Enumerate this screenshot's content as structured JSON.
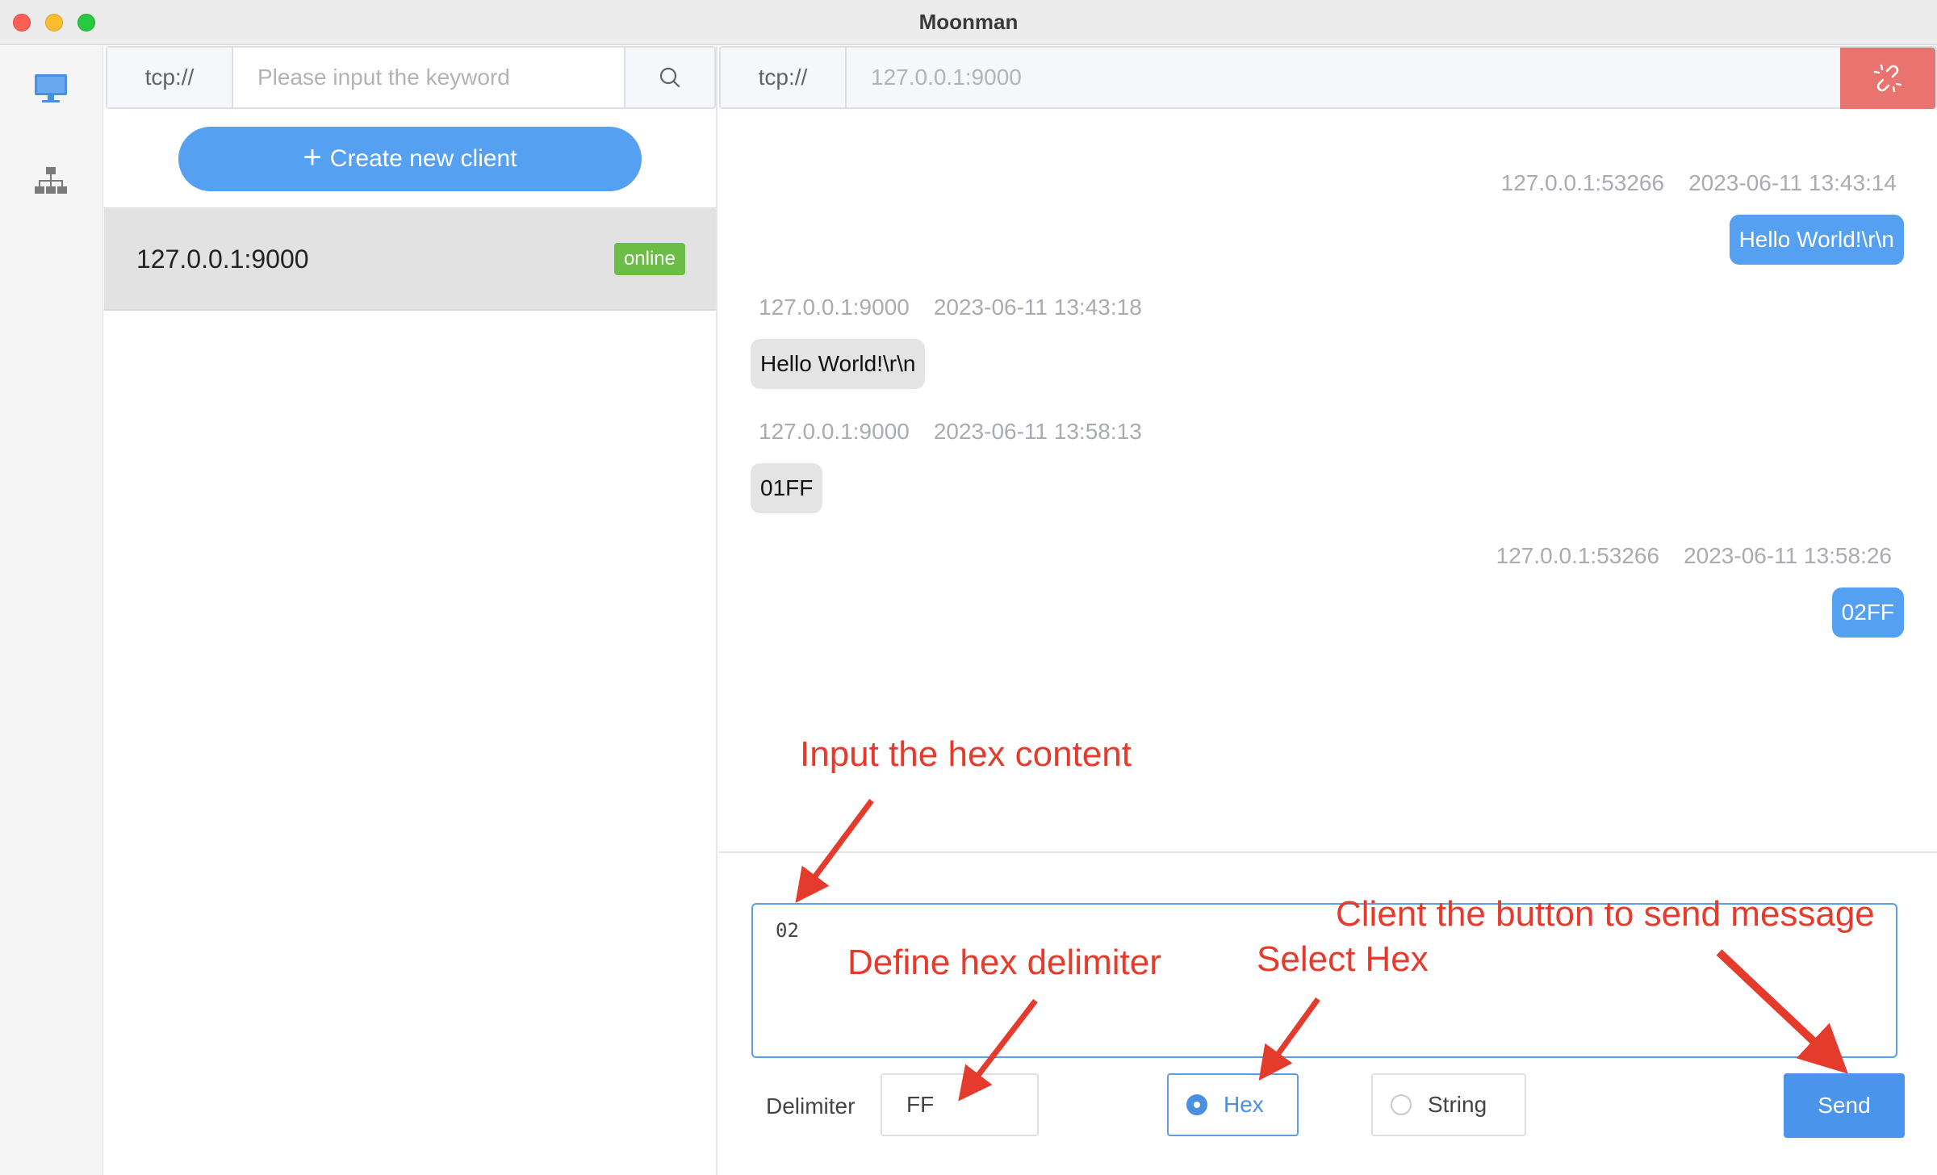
{
  "window": {
    "title": "Moonman"
  },
  "client_panel": {
    "search": {
      "prefix": "tcp://",
      "placeholder": "Please input the keyword"
    },
    "create_button": {
      "icon": "+",
      "label": "Create new client"
    },
    "clients": [
      {
        "address": "127.0.0.1:9000",
        "status": "online"
      }
    ]
  },
  "chat": {
    "address_bar": {
      "prefix": "tcp://",
      "value": "127.0.0.1:9000"
    },
    "messages": [
      {
        "direction": "out",
        "source": "127.0.0.1:53266",
        "time": "2023-06-11 13:43:14",
        "text": "Hello World!\\r\\n"
      },
      {
        "direction": "in",
        "source": "127.0.0.1:9000",
        "time": "2023-06-11 13:43:18",
        "text": "Hello World!\\r\\n"
      },
      {
        "direction": "in",
        "source": "127.0.0.1:9000",
        "time": "2023-06-11 13:58:13",
        "text": "01FF"
      },
      {
        "direction": "out",
        "source": "127.0.0.1:53266",
        "time": "2023-06-11 13:58:26",
        "text": "02FF"
      }
    ],
    "composer": {
      "content": "02",
      "delimiter_label": "Delimiter",
      "delimiter_value": "FF",
      "format_options": [
        {
          "label": "Hex",
          "selected": true
        },
        {
          "label": "String",
          "selected": false
        }
      ],
      "send_label": "Send"
    }
  },
  "annotations": {
    "input_hint": "Input the hex content",
    "delimiter_hint": "Define hex delimiter",
    "hex_hint": "Select Hex",
    "send_hint": "Client the button to send message"
  },
  "colors": {
    "accent": "#56a0f2",
    "online": "#6cbd45",
    "disconnect": "#e8736f",
    "annotation": "#e53b2c"
  }
}
